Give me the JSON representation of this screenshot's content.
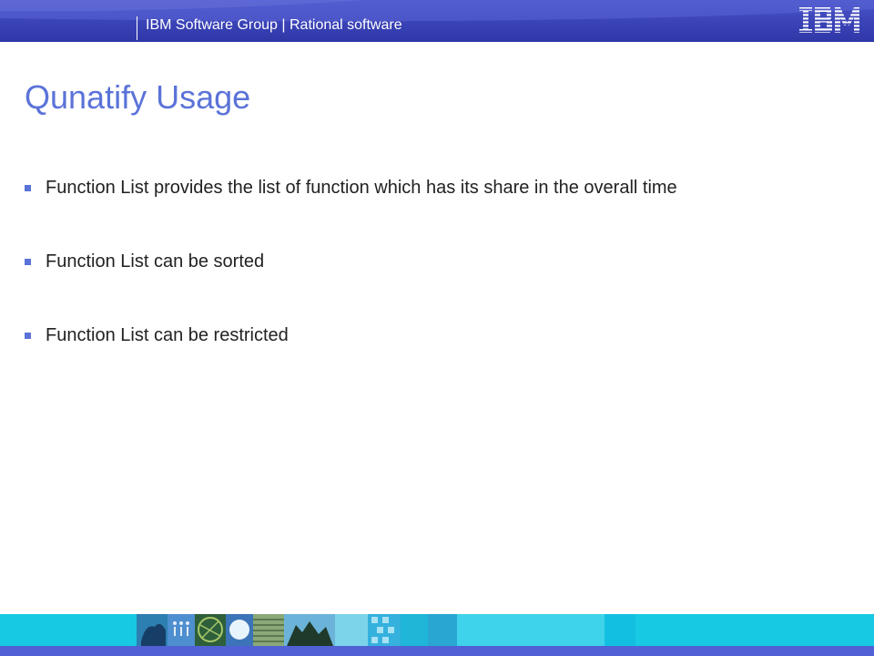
{
  "header": {
    "text": "IBM Software Group | Rational software",
    "logo": "IBM"
  },
  "slide": {
    "title": "Qunatify Usage",
    "bullets": [
      "Function List provides the list of function which has its share in the overall time",
      "Function List can be sorted",
      "Function List can be restricted"
    ]
  },
  "colors": {
    "header_band": "#3a43b6",
    "title": "#5b73d8",
    "bullet_marker": "#5b73d8",
    "footer_strip": "#18c9e3",
    "footer_bar": "#5160d4"
  }
}
